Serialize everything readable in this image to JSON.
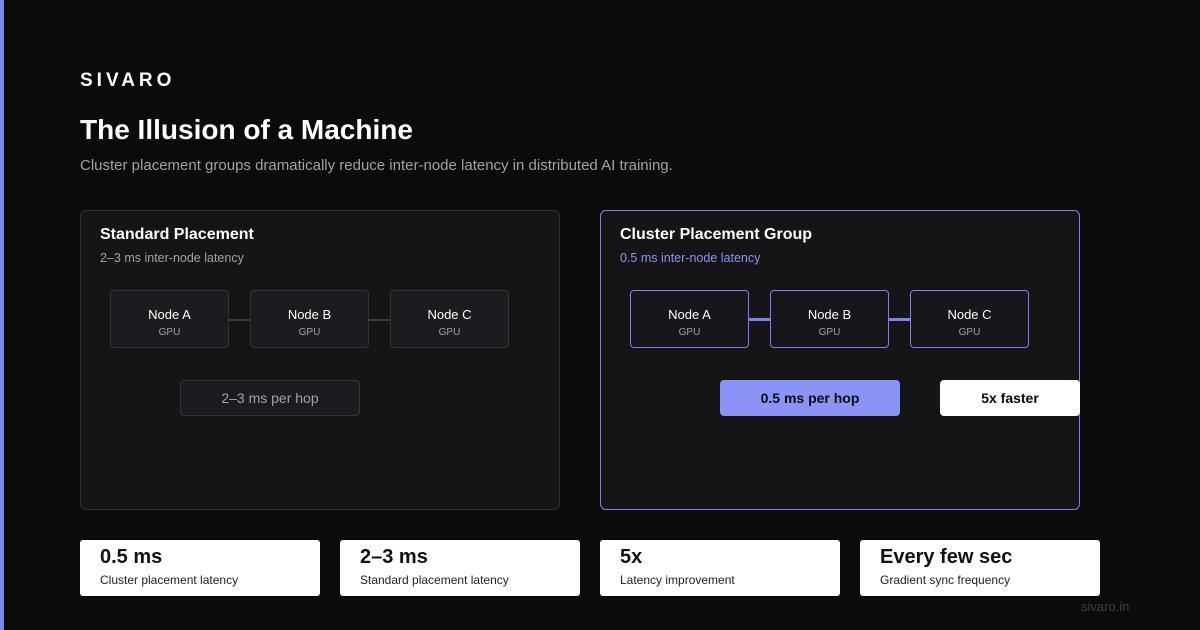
{
  "brand": "SIVARO",
  "title": "The Illusion of a Machine",
  "subtitle": "Cluster placement groups dramatically reduce inter-node latency in distributed AI training.",
  "colors": {
    "accent": "#7b83f0",
    "background": "#0b0b0c",
    "panel": "#151518"
  },
  "standard": {
    "title": "Standard Placement",
    "latency": "2–3 ms inter-node latency",
    "nodes": [
      {
        "name": "Node A",
        "type": "GPU"
      },
      {
        "name": "Node B",
        "type": "GPU"
      },
      {
        "name": "Node C",
        "type": "GPU"
      }
    ],
    "hop": "2–3 ms per hop"
  },
  "cluster": {
    "title": "Cluster Placement Group",
    "latency": "0.5 ms inter-node latency",
    "nodes": [
      {
        "name": "Node A",
        "type": "GPU"
      },
      {
        "name": "Node B",
        "type": "GPU"
      },
      {
        "name": "Node C",
        "type": "GPU"
      }
    ],
    "hop": "0.5 ms per hop",
    "badge": "5x faster"
  },
  "stats": [
    {
      "value": "0.5 ms",
      "label": "Cluster placement latency"
    },
    {
      "value": "2–3 ms",
      "label": "Standard placement latency"
    },
    {
      "value": "5x",
      "label": "Latency improvement"
    },
    {
      "value": "Every few sec",
      "label": "Gradient sync frequency"
    }
  ],
  "footer": "sivaro.in"
}
